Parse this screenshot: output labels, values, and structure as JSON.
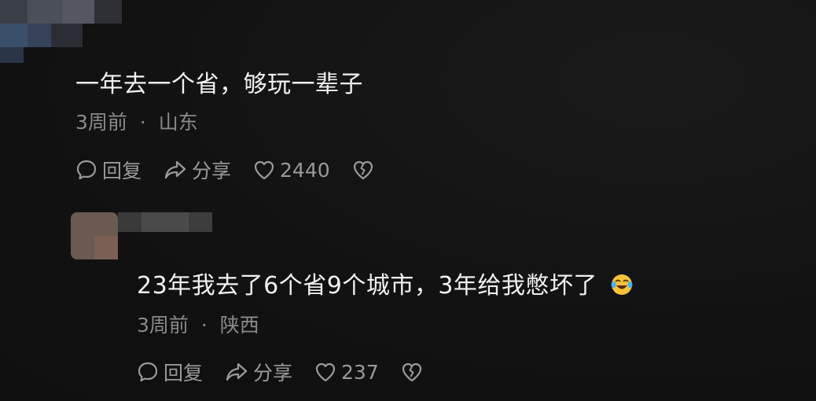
{
  "comments": [
    {
      "text": "一年去一个省，够玩一辈子",
      "time": "3周前",
      "separator": "·",
      "location": "山东",
      "reply_label": "回复",
      "share_label": "分享",
      "like_count": "2440",
      "icons": [
        "reply-bubble-icon",
        "share-arrow-icon",
        "heart-icon",
        "broken-heart-icon"
      ]
    },
    {
      "text": "23年我去了6个省9个城市，3年给我憋坏了",
      "emoji": "laughing-crying-emoji",
      "time": "3周前",
      "separator": "·",
      "location": "陕西",
      "reply_label": "回复",
      "share_label": "分享",
      "like_count": "237",
      "icons": [
        "reply-bubble-icon",
        "share-arrow-icon",
        "heart-icon",
        "broken-heart-icon"
      ]
    }
  ],
  "colors": {
    "background": "#121212",
    "text": "#f2f2f2",
    "meta": "#8a8a8a",
    "action": "#9a9a9a"
  }
}
